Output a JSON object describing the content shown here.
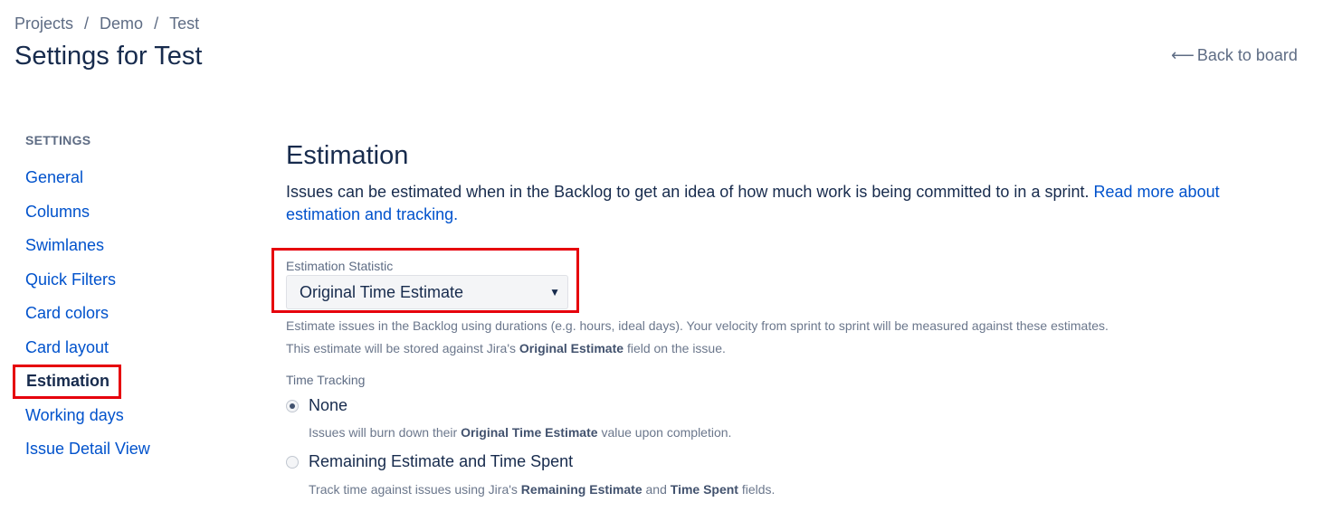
{
  "breadcrumb": [
    "Projects",
    "Demo",
    "Test"
  ],
  "page_title": "Settings for Test",
  "back_link": "Back to board",
  "sidebar": {
    "heading": "SETTINGS",
    "items": [
      {
        "label": "General"
      },
      {
        "label": "Columns"
      },
      {
        "label": "Swimlanes"
      },
      {
        "label": "Quick Filters"
      },
      {
        "label": "Card colors"
      },
      {
        "label": "Card layout"
      },
      {
        "label": "Estimation",
        "active": true
      },
      {
        "label": "Working days"
      },
      {
        "label": "Issue Detail View"
      }
    ]
  },
  "main": {
    "title": "Estimation",
    "intro": "Issues can be estimated when in the Backlog to get an idea of how much work is being committed to in a sprint.",
    "intro_link": "Read more about estimation and tracking.",
    "estimation_statistic": {
      "label": "Estimation Statistic",
      "selected": "Original Time Estimate",
      "help_pre": "Estimate issues in the Backlog using durations (e.g. hours, ideal days). Your velocity from sprint to sprint will be measured against these estimates. This estimate will be stored against Jira's",
      "help_bold": "Original Estimate",
      "help_post": "field on the issue."
    },
    "time_tracking": {
      "label": "Time Tracking",
      "options": [
        {
          "label": "None",
          "checked": true,
          "desc_pre": "Issues will burn down their",
          "desc_bold": "Original Time Estimate",
          "desc_post": "value upon completion."
        },
        {
          "label": "Remaining Estimate and Time Spent",
          "checked": false,
          "desc_pre": "Track time against issues using Jira's",
          "desc_bold": "Remaining Estimate",
          "desc_mid": "and",
          "desc_bold2": "Time Spent",
          "desc_post": "fields."
        }
      ]
    }
  },
  "colors": {
    "link": "#0052cc",
    "text": "#172b4d",
    "highlight": "#e6000c",
    "muted": "#6b778c"
  }
}
